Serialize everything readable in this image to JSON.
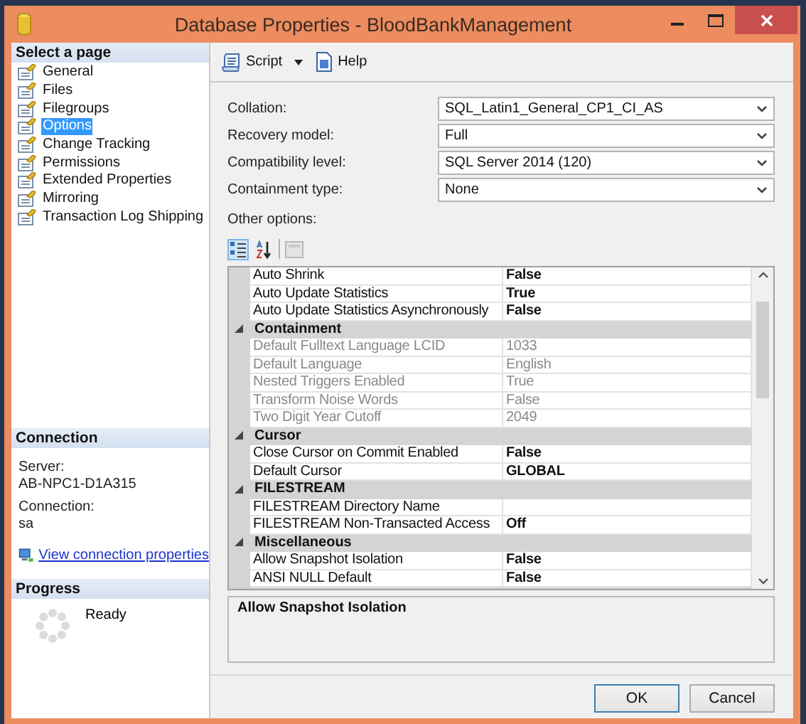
{
  "window": {
    "title": "Database Properties - BloodBankManagement"
  },
  "sidebar": {
    "header": "Select a page",
    "items": [
      {
        "label": "General",
        "selected": false
      },
      {
        "label": "Files",
        "selected": false
      },
      {
        "label": "Filegroups",
        "selected": false
      },
      {
        "label": "Options",
        "selected": true
      },
      {
        "label": "Change Tracking",
        "selected": false
      },
      {
        "label": "Permissions",
        "selected": false
      },
      {
        "label": "Extended Properties",
        "selected": false
      },
      {
        "label": "Mirroring",
        "selected": false
      },
      {
        "label": "Transaction Log Shipping",
        "selected": false
      }
    ]
  },
  "connection": {
    "header": "Connection",
    "server_label": "Server:",
    "server": "AB-NPC1-D1A315",
    "connection_label": "Connection:",
    "connection": "sa",
    "link": "View connection properties"
  },
  "progress": {
    "header": "Progress",
    "status": "Ready"
  },
  "toolbar": [
    {
      "kind": "script",
      "label": "Script"
    },
    {
      "kind": "help",
      "label": "Help"
    }
  ],
  "fields": [
    {
      "label": "Collation:",
      "value": "SQL_Latin1_General_CP1_CI_AS"
    },
    {
      "label": "Recovery model:",
      "value": "Full"
    },
    {
      "label": "Compatibility level:",
      "value": "SQL Server 2014 (120)"
    },
    {
      "label": "Containment type:",
      "value": "None"
    }
  ],
  "other_options": {
    "label": "Other options:",
    "view_buttons": [
      {
        "kind": "categorized",
        "selected": true
      },
      {
        "kind": "alphabetical",
        "selected": false
      }
    ],
    "rows": [
      {
        "kind": "property",
        "name": "Auto Shrink",
        "value": "False",
        "disabled": false
      },
      {
        "kind": "property",
        "name": "Auto Update Statistics",
        "value": "True",
        "disabled": false
      },
      {
        "kind": "property",
        "name": "Auto Update Statistics Asynchronously",
        "value": "False",
        "disabled": false
      },
      {
        "kind": "category",
        "name": "Containment",
        "expanded": true
      },
      {
        "kind": "property",
        "name": "Default Fulltext Language LCID",
        "value": "1033",
        "disabled": true
      },
      {
        "kind": "property",
        "name": "Default Language",
        "value": "English",
        "disabled": true
      },
      {
        "kind": "property",
        "name": "Nested Triggers Enabled",
        "value": "True",
        "disabled": true
      },
      {
        "kind": "property",
        "name": "Transform Noise Words",
        "value": "False",
        "disabled": true
      },
      {
        "kind": "property",
        "name": "Two Digit Year Cutoff",
        "value": "2049",
        "disabled": true
      },
      {
        "kind": "category",
        "name": "Cursor",
        "expanded": true
      },
      {
        "kind": "property",
        "name": "Close Cursor on Commit Enabled",
        "value": "False",
        "disabled": false
      },
      {
        "kind": "property",
        "name": "Default Cursor",
        "value": "GLOBAL",
        "disabled": false
      },
      {
        "kind": "category",
        "name": "FILESTREAM",
        "expanded": true
      },
      {
        "kind": "property",
        "name": "FILESTREAM Directory Name",
        "disabled": false
      },
      {
        "kind": "property",
        "name": "FILESTREAM Non-Transacted Access",
        "value": "Off",
        "disabled": false
      },
      {
        "kind": "category",
        "name": "Miscellaneous",
        "expanded": true
      },
      {
        "kind": "property",
        "name": "Allow Snapshot Isolation",
        "value": "False",
        "disabled": false
      },
      {
        "kind": "property",
        "name": "ANSI NULL Default",
        "value": "False",
        "disabled": false
      }
    ]
  },
  "description": "Allow Snapshot Isolation",
  "buttons": [
    {
      "label": "OK",
      "default": true
    },
    {
      "label": "Cancel",
      "default": false
    }
  ]
}
